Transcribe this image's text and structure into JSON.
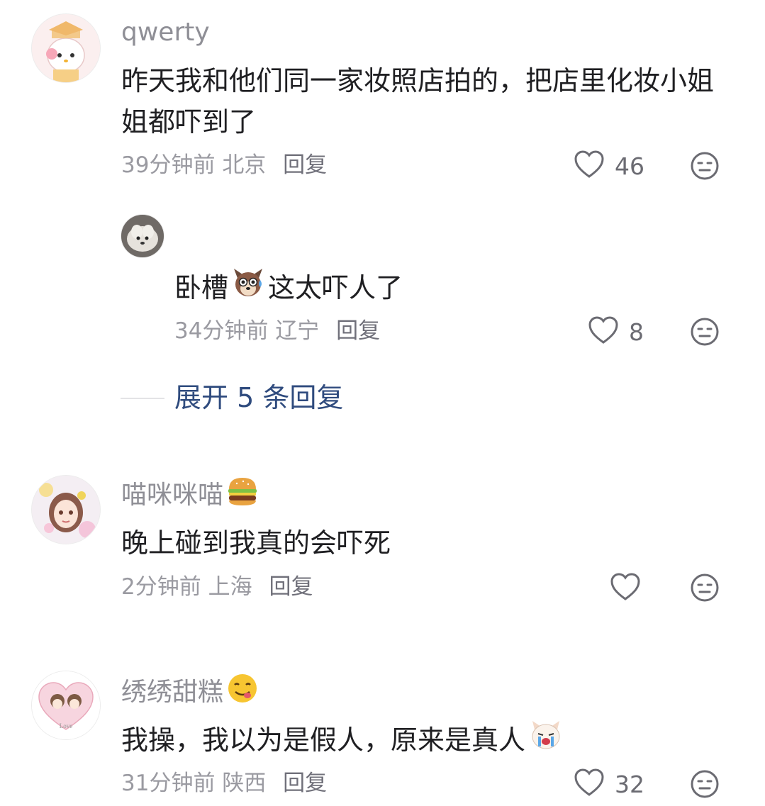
{
  "comments": [
    {
      "username": "qwerty",
      "text": "昨天我和他们同一家妆照店拍的，把店里化妆小姐姐都吓到了",
      "time": "39分钟前",
      "location": "北京",
      "reply": "回复",
      "likes": "46"
    },
    {
      "text_part1": "卧槽",
      "emoji": "dog-sweat-emoji",
      "text_part2": "这太吓人了",
      "time": "34分钟前",
      "location": "辽宁",
      "reply": "回复",
      "likes": "8"
    },
    {
      "username": "喵咪咪喵",
      "username_emoji": "hamburger-emoji",
      "text": "晚上碰到我真的会吓死",
      "time": "2分钟前",
      "location": "上海",
      "reply": "回复",
      "likes": ""
    },
    {
      "username": "绣绣甜糕",
      "username_emoji": "yum-face-emoji",
      "text": "我操，我以为是假人，原来是真人",
      "text_emoji": "crying-dog-emoji",
      "time": "31分钟前",
      "location": "陕西",
      "reply": "回复",
      "likes": "32"
    }
  ],
  "expand_replies": "展开 5 条回复",
  "avatar_labels": {
    "love": "Love"
  }
}
